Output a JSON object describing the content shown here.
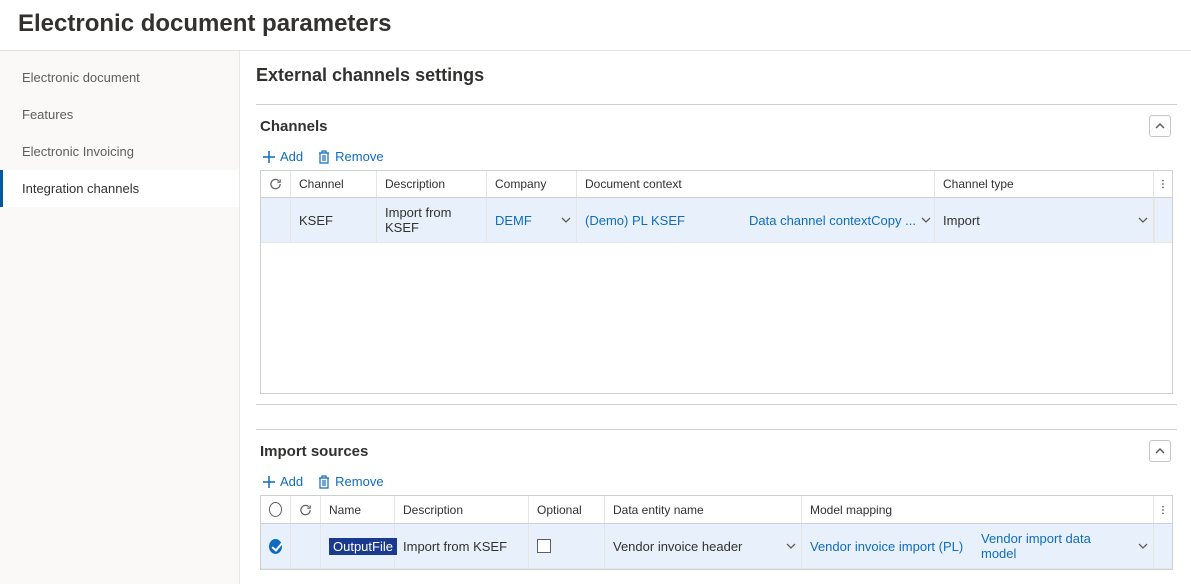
{
  "page_title": "Electronic document parameters",
  "sidebar": {
    "items": [
      {
        "label": "Electronic document",
        "active": false
      },
      {
        "label": "Features",
        "active": false
      },
      {
        "label": "Electronic Invoicing",
        "active": false
      },
      {
        "label": "Integration channels",
        "active": true
      }
    ]
  },
  "main": {
    "title": "External channels settings",
    "toolbar": {
      "add_label": "Add",
      "remove_label": "Remove"
    },
    "channels_section": {
      "title": "Channels",
      "columns": {
        "channel": "Channel",
        "description": "Description",
        "company": "Company",
        "document_context": "Document context",
        "channel_type": "Channel type"
      },
      "rows": [
        {
          "channel": "KSEF",
          "description": "Import from KSEF",
          "company": "DEMF",
          "doc_context_left": "(Demo) PL KSEF",
          "doc_context_right": "Data channel contextCopy ...",
          "channel_type": "Import"
        }
      ]
    },
    "import_section": {
      "title": "Import sources",
      "columns": {
        "name": "Name",
        "description": "Description",
        "optional": "Optional",
        "data_entity": "Data entity name",
        "model_mapping": "Model mapping"
      },
      "rows": [
        {
          "selected": true,
          "name": "OutputFile",
          "description": "Import from KSEF",
          "optional": false,
          "data_entity": "Vendor invoice header",
          "model_mapping_left": "Vendor invoice import (PL)",
          "model_mapping_right": "Vendor import data model"
        }
      ]
    }
  }
}
